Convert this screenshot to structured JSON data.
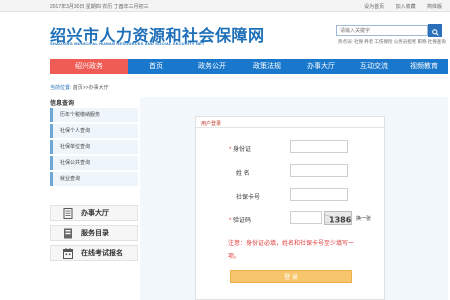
{
  "topbar": {
    "date": "2017年3月30日 星期四 农历 丁酉年三月初三",
    "links": [
      "设为首页",
      "加入收藏",
      "简体版"
    ]
  },
  "header": {
    "title_cn": "绍兴市人力资源和社会保障网",
    "title_en": "SHAOXING MUNICIPAL HUMAN RESOURCES AND SOCIAL SECURITY NET",
    "search_placeholder": "请输入关键字",
    "hot_words": "热点词: 社保 养老 工伤保险 公务员招考 职称 社保查询"
  },
  "nav": {
    "tabs": [
      {
        "label": "绍兴政务",
        "active": true
      },
      {
        "label": "首页",
        "active": false
      },
      {
        "label": "政务公开",
        "active": false
      },
      {
        "label": "政策法规",
        "active": false
      },
      {
        "label": "办事大厅",
        "active": false
      },
      {
        "label": "互动交流",
        "active": false
      },
      {
        "label": "视频教育",
        "active": false
      }
    ]
  },
  "breadcrumb": {
    "label": "当前位置:",
    "path": "首页>>办事大厅"
  },
  "left": {
    "title": "信息查询",
    "items": [
      "历年个税缴纳服务",
      "社保个人查询",
      "社保单位查询",
      "社保公共查询",
      "就业查询"
    ]
  },
  "services": [
    {
      "label": "办事大厅",
      "icon": "document-icon"
    },
    {
      "label": "服务目录",
      "icon": "book-icon"
    },
    {
      "label": "在线考试报名",
      "icon": "calendar-icon"
    }
  ],
  "login": {
    "title": "用户登录",
    "fields": {
      "id": {
        "label": "身份证",
        "required": true
      },
      "name": {
        "label": "姓 名",
        "required": false
      },
      "card": {
        "label": "社保卡号",
        "required": false
      },
      "captcha": {
        "label": "验证码",
        "required": true
      }
    },
    "captcha_text": "1386",
    "change_text": "换一张",
    "note": "注意：身份证必填，姓名和社保卡号至少填写一项。",
    "submit_label": "登 录"
  },
  "colors": {
    "nav_blue": "#1978cc",
    "nav_active": "#ef5b55",
    "brand_blue": "#1d6fb8",
    "submit": "#f7c56b",
    "alert": "#e03a3a"
  }
}
